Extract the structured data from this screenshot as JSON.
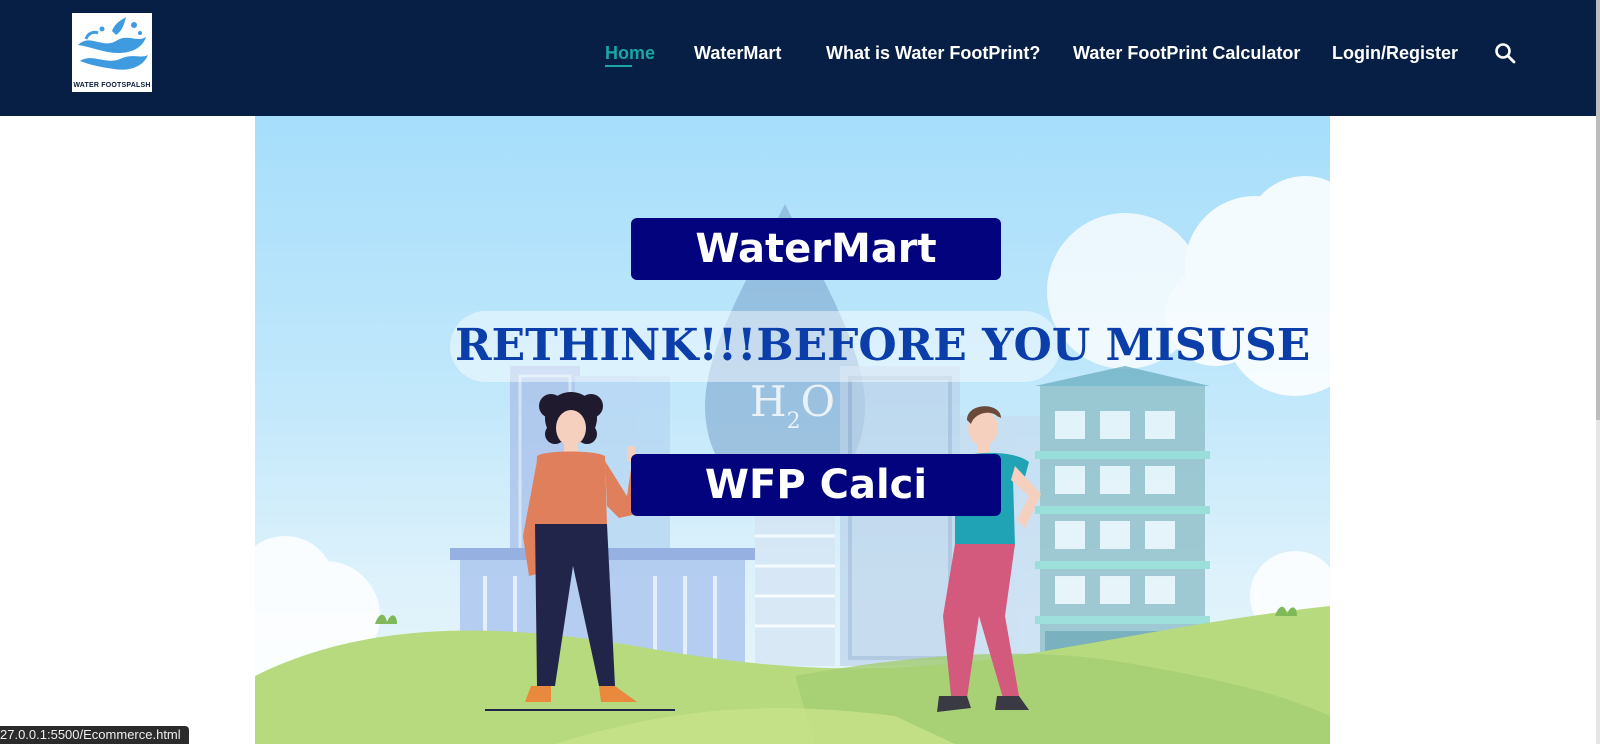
{
  "logo": {
    "text": "WATER FOOTSPALSH"
  },
  "nav": {
    "items": [
      {
        "label": "Home",
        "active": true
      },
      {
        "label": "WaterMart",
        "active": false
      },
      {
        "label": "What is Water FootPrint?",
        "active": false
      },
      {
        "label": "Water FootPrint Calculator",
        "active": false
      },
      {
        "label": "Login/Register",
        "active": false
      }
    ],
    "search_icon": "search-icon"
  },
  "hero": {
    "watermart_label": "WaterMart",
    "slogan": "RETHINK!!!BEFORE YOU MISUSE",
    "wfp_label": "WFP Calci",
    "h2o_text": "H",
    "h2o_sub": "2",
    "h2o_o": "O"
  },
  "status_bar": {
    "url": "27.0.0.1:5500/Ecommerce.html"
  },
  "colors": {
    "navbar": "#071f44",
    "active_link": "#1aa6a6",
    "button_bg": "#03037e",
    "slogan_text": "#0b3ea8"
  }
}
